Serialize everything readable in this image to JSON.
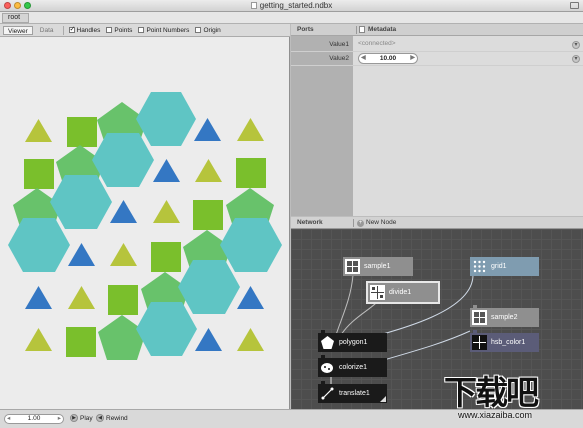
{
  "window": {
    "title": "getting_started.ndbx",
    "traffic_lights": [
      "#fc605c",
      "#fdbc40",
      "#34c84a"
    ]
  },
  "breadcrumb": {
    "root": "root"
  },
  "viewer": {
    "tabs": [
      "Viewer",
      "Data"
    ],
    "active_tab": "Viewer",
    "options": [
      {
        "label": "Handles",
        "checked": true
      },
      {
        "label": "Points",
        "checked": false
      },
      {
        "label": "Point Numbers",
        "checked": false
      },
      {
        "label": "Origin",
        "checked": false
      }
    ],
    "colors": {
      "light_green": "#b6c43c",
      "green": "#7abf2c",
      "mid_green": "#68c26b",
      "teal": "#5fc5c4",
      "blue": "#3477c3"
    }
  },
  "ports": {
    "title": "Ports",
    "metadata_label": "Metadata",
    "rows": [
      {
        "label": "Value1",
        "value": "<connected>"
      },
      {
        "label": "Value2",
        "value": "10.00"
      }
    ]
  },
  "network": {
    "title": "Network",
    "new_node": "New Node",
    "nodes": [
      {
        "id": "sample1",
        "label": "sample1",
        "style": "gray",
        "icon": "sample-grid-icon"
      },
      {
        "id": "grid1",
        "label": "grid1",
        "style": "blue",
        "icon": "grid-dots-icon"
      },
      {
        "id": "divide1",
        "label": "divide1",
        "style": "gray",
        "icon": "divide-icon"
      },
      {
        "id": "sample2",
        "label": "sample2",
        "style": "gray",
        "icon": "sample-grid-icon"
      },
      {
        "id": "polygon1",
        "label": "polygon1",
        "style": "dark",
        "icon": "polygon-icon"
      },
      {
        "id": "hsb_color1",
        "label": "hsb_color1",
        "style": "purple",
        "icon": "color-icon"
      },
      {
        "id": "colorize1",
        "label": "colorize1",
        "style": "dark",
        "icon": "colorize-icon"
      },
      {
        "id": "translate1",
        "label": "translate1",
        "style": "dark",
        "icon": "translate-icon"
      }
    ]
  },
  "status": {
    "frame": "1.00",
    "play": "Play",
    "rewind": "Rewind"
  },
  "watermark": {
    "big": "下载吧",
    "small": "www.xiazaiba.com"
  }
}
